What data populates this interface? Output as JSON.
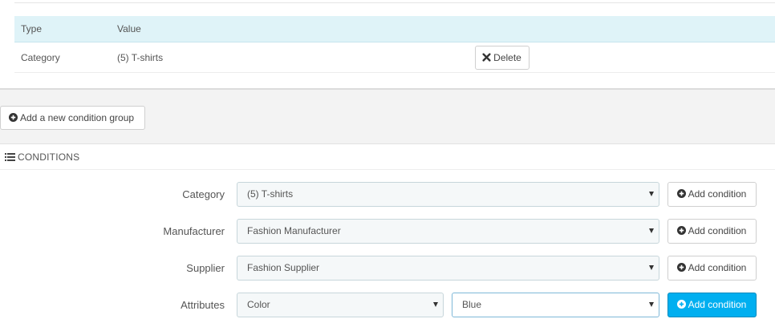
{
  "table": {
    "columns": [
      "Type",
      "Value"
    ],
    "rows": [
      {
        "type": "Category",
        "value": "(5) T-shirts",
        "action_label": "Delete"
      }
    ]
  },
  "group": {
    "add_group_label": "Add a new condition group"
  },
  "conditions": {
    "heading": "CONDITIONS",
    "add_condition_label": "Add condition",
    "rows": [
      {
        "label": "Category",
        "selected": "(5) T-shirts"
      },
      {
        "label": "Manufacturer",
        "selected": "Fashion Manufacturer"
      },
      {
        "label": "Supplier",
        "selected": "Fashion Supplier"
      },
      {
        "label": "Attributes",
        "selected": "Color",
        "selected_secondary": "Blue"
      }
    ]
  },
  "icons": {
    "delete": "times-icon",
    "add": "plus-circle-icon",
    "heading": "list-icon"
  },
  "colors": {
    "table_header_bg": "#dff3f8",
    "primary_button": "#00aff0",
    "band_bg": "#f3f3f3"
  }
}
